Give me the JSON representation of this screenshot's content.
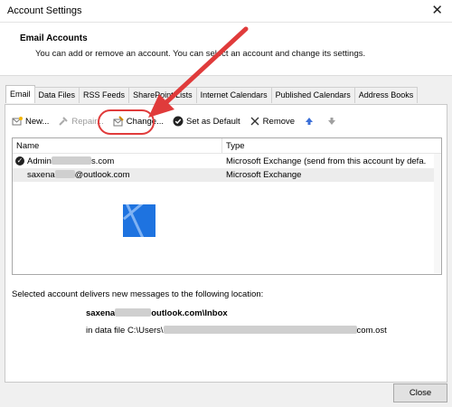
{
  "window": {
    "title": "Account Settings",
    "close_glyph": "✕"
  },
  "header": {
    "title": "Email Accounts",
    "description": "You can add or remove an account. You can select an account and change its settings."
  },
  "tabs": [
    {
      "label": "Email",
      "active": true
    },
    {
      "label": "Data Files"
    },
    {
      "label": "RSS Feeds"
    },
    {
      "label": "SharePoint Lists"
    },
    {
      "label": "Internet Calendars"
    },
    {
      "label": "Published Calendars"
    },
    {
      "label": "Address Books"
    }
  ],
  "toolbar": {
    "new_label": "New...",
    "repair_label": "Repair...",
    "change_label": "Change...",
    "default_label": "Set as Default",
    "remove_label": "Remove"
  },
  "list": {
    "col_name": "Name",
    "col_type": "Type",
    "rows": [
      {
        "name_prefix": "Admin",
        "name_suffix": "s.com",
        "type": "Microsoft Exchange (send from this account by defa..."
      },
      {
        "name_prefix": "saxena",
        "name_suffix": "@outlook.com",
        "type": "Microsoft Exchange"
      }
    ]
  },
  "delivery": {
    "label": "Selected account delivers new messages to the following location:",
    "path_prefix": "saxena",
    "path_suffix": "outlook.com\\Inbox",
    "datafile_prefix": "in data file C:\\Users\\",
    "datafile_suffix": "com.ost"
  },
  "footer": {
    "close_label": "Close"
  },
  "colors": {
    "annotation": "#e03b3b",
    "windows_logo": "#1e73e0"
  }
}
